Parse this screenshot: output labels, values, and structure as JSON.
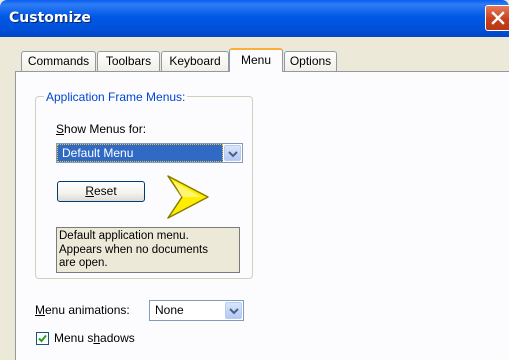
{
  "window": {
    "title": "Customize"
  },
  "tabs": [
    {
      "label": "Commands"
    },
    {
      "label": "Toolbars"
    },
    {
      "label": "Keyboard"
    },
    {
      "label": "Menu",
      "active": true
    },
    {
      "label": "Options"
    }
  ],
  "app_frame_menus": {
    "legend": "Application Frame Menus:",
    "show_menus_label_prefix": "S",
    "show_menus_label_rest": "how Menus for:",
    "show_menus_value": "Default Menu",
    "reset_prefix": "R",
    "reset_rest": "eset",
    "description_line1": "Default application menu.",
    "description_line2": "Appears when no documents",
    "description_line3": "are open."
  },
  "menu_animations": {
    "label_prefix": "M",
    "label_rest": "enu animations:",
    "value": "None"
  },
  "menu_shadows": {
    "label_pre": "Menu s",
    "label_u": "h",
    "label_post": "adows",
    "checked": true
  },
  "colors": {
    "titlebar": "#0058e6",
    "legend_text": "#0046d5",
    "selection": "#316ac5",
    "tab_highlight": "#f7b13a",
    "pointer_arrow": "#ffee00"
  }
}
